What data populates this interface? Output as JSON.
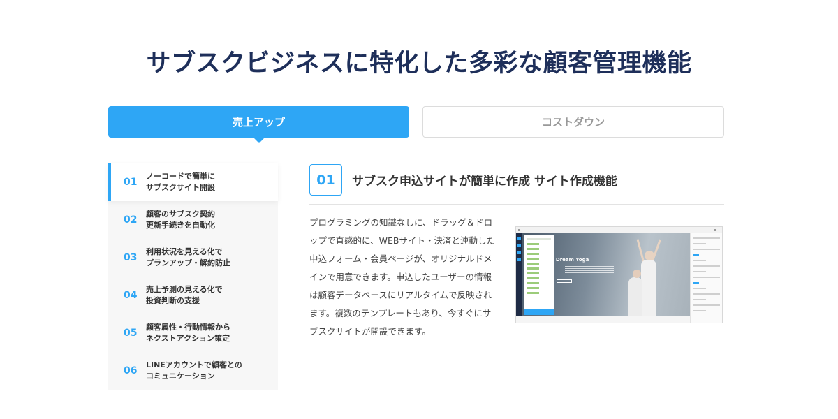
{
  "heading": "サブスクビジネスに特化した多彩な顧客管理機能",
  "tabs": [
    {
      "label": "売上アップ",
      "active": true
    },
    {
      "label": "コストダウン",
      "active": false
    }
  ],
  "menu": [
    {
      "num": "01",
      "label": "ノーコードで簡単に\nサブスクサイト開設",
      "active": true
    },
    {
      "num": "02",
      "label": "顧客のサブスク契約\n更新手続きを自動化",
      "active": false
    },
    {
      "num": "03",
      "label": "利用状況を見える化で\nプランアップ・解約防止",
      "active": false
    },
    {
      "num": "04",
      "label": "売上予測の見える化で\n投資判断の支援",
      "active": false
    },
    {
      "num": "05",
      "label": "顧客属性・行動情報から\nネクストアクション策定",
      "active": false
    },
    {
      "num": "06",
      "label": "LINEアカウントで顧客との\nコミュニケーション",
      "active": false
    }
  ],
  "content": {
    "num": "01",
    "title": "サブスク申込サイトが簡単に作成 サイト作成機能",
    "description": "プログラミングの知識なしに、ドラッグ＆ドロップで直感的に、WEBサイト・決済と連動した申込フォーム・会員ページが、オリジナルドメインで用意できます。申込したユーザーの情報は顧客データベースにリアルタイムで反映されます。複数のテンプレートもあり、今すぐにサブスクサイトが開設できます。",
    "screenshot_text": "r Dream Yoga"
  },
  "colors": {
    "accent": "#2ea6f5",
    "heading": "#1e2f5a"
  }
}
